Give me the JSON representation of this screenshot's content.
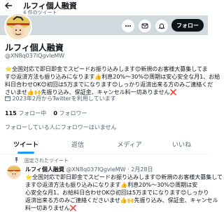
{
  "header": {
    "display_name": "ルフィ個人融資",
    "post_count": "4 件のツイート"
  },
  "profile": {
    "display_name": "ルフィ個人融資",
    "handle": "@XN8q037lQgvleMW",
    "bio_lines": [
      "⭐全国対応で即日即金でスピードお振り込みします😊新規のお客様大募集してま",
      "す😊返済方法も振り込みになります👍利息20%〜30%😊周期は安心安全な月1、お給",
      "料日合わせOK😊初回は5万までになります😊しっかり返済出来る方のみご連絡くだ",
      "さいませ👍🙌先振り込み、保証金、キャンセル料一切ありません❌"
    ],
    "joined": "2023年2月からTwitterを利用しています",
    "following_count": "115",
    "following_label": "フォロー中",
    "followers_count": "0",
    "followers_label": "フォロワー",
    "no_known_followers": "フォローしている人にフォロワーはいません"
  },
  "actions": {
    "follow_label": "フォロー"
  },
  "tabs": [
    {
      "label": "ツイート",
      "active": true
    },
    {
      "label": "返信",
      "active": false
    },
    {
      "label": "メディア",
      "active": false
    },
    {
      "label": "いいね",
      "active": false
    }
  ],
  "pinned_tweet": {
    "pinned_label": "固定されたツイート",
    "author": "ルフィ個人融資",
    "handle_date": "@XN8q037lQgvleMW · 2月28日",
    "text_lines": [
      "⭐全国対応で即日即金でスピードお振り込みします😊新規のお客様大募集して",
      "ます😊返済方法も振り込みになります👍利息20%〜30%😊周期は安",
      "心安全な月1、お給料日合わせOK😊初回は5万までになります😊しっかり",
      "返済出来る方のみご連絡くださいませ👍🙌先振り込み、保証金、キャンセル",
      "料一切ありません❌"
    ]
  },
  "colors": {
    "accent": "#1d9bf0",
    "banner": "#cfd9de",
    "text_secondary": "#536471"
  }
}
